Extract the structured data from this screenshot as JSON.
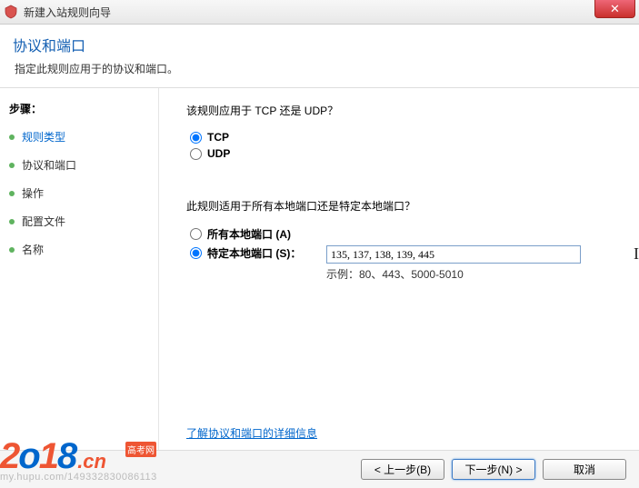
{
  "titlebar": {
    "title": "新建入站规则向导",
    "close_glyph": "✕"
  },
  "header": {
    "title": "协议和端口",
    "subtitle": "指定此规则应用于的协议和端口。"
  },
  "sidebar": {
    "steps_label": "步骤：",
    "items": [
      {
        "label": "规则类型",
        "active": true
      },
      {
        "label": "协议和端口",
        "active": false
      },
      {
        "label": "操作",
        "active": false
      },
      {
        "label": "配置文件",
        "active": false
      },
      {
        "label": "名称",
        "active": false
      }
    ]
  },
  "main": {
    "q1": "该规则应用于 TCP 还是 UDP？",
    "tcp": "TCP",
    "udp": "UDP",
    "q2": "此规则适用于所有本地端口还是特定本地端口？",
    "all_ports": "所有本地端口 (A)",
    "specific_ports": "特定本地端口 (S)：",
    "ports_value": "135, 137, 138, 139, 445",
    "example": "示例：80、443、5000-5010",
    "learn_more": "了解协议和端口的详细信息"
  },
  "footer": {
    "back": "< 上一步(B)",
    "next": "下一步(N) >",
    "cancel": "取消"
  },
  "watermark": {
    "y": "2o18",
    "cn": ".cn",
    "gkw": "高考网",
    "url": "my.hupu.com/149332830086113"
  }
}
